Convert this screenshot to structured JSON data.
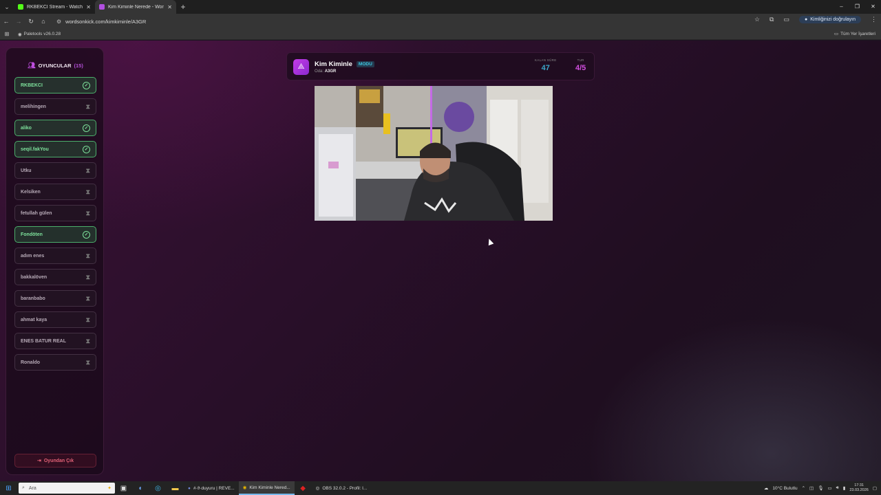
{
  "browser": {
    "tabs": [
      {
        "title": "RKBEKCI Stream - Watch Live o",
        "active": false,
        "favicon_color": "#53fc18"
      },
      {
        "title": "Kim Kiminle Nerede - Words O",
        "active": true,
        "favicon_color": "#b14fe0"
      }
    ],
    "url": "wordsonkick.com/kimkiminle/A3GR",
    "profile_label": "Kimliğinizi doğrulayın",
    "bookmark": "Paletools v26.0.28",
    "all_bookmarks": "Tüm Yer İşaretleri"
  },
  "sidebar": {
    "title": "OYUNCULAR",
    "count_open": "(",
    "count": "15",
    "count_close": ")",
    "players": [
      {
        "name": "RKBEKCI",
        "done": true
      },
      {
        "name": "melihingen",
        "done": false
      },
      {
        "name": "aliko",
        "done": true
      },
      {
        "name": "seqil.fakYou",
        "done": true
      },
      {
        "name": "Utku",
        "done": false
      },
      {
        "name": "Kelsiken",
        "done": false
      },
      {
        "name": "fetullah gülen",
        "done": false
      },
      {
        "name": "Fondöten",
        "done": true
      },
      {
        "name": "adım enes",
        "done": false
      },
      {
        "name": "bakkalöven",
        "done": false
      },
      {
        "name": "baranbabo",
        "done": false
      },
      {
        "name": "ahmat kaya",
        "done": false
      },
      {
        "name": "ENES BATUR REAL",
        "done": false
      },
      {
        "name": "Ronaldo",
        "done": false
      }
    ],
    "leave_label": "Oyundan Çık"
  },
  "game": {
    "title": "Kim Kiminle",
    "mode": "MODU",
    "room_label": "Oda:",
    "room_code": "A3GR",
    "remaining_label": "KALAN SÜRE",
    "remaining_value": "47",
    "round_label": "TUR",
    "round_value": "4/5",
    "colors": {
      "remaining": "#3aa6c8",
      "round": "#d24fe0"
    }
  },
  "taskbar": {
    "search_placeholder": "Ara",
    "apps": [
      {
        "label": "#·ϑ·duyuru | REVE...",
        "active": false
      },
      {
        "label": "Kim Kiminle Nered...",
        "active": true
      },
      {
        "label": "OBS 32.0.2 - Profil: I...",
        "active": false
      }
    ],
    "weather": "10°C  Bulutlu",
    "time": "17:31",
    "date": "23.03.2026"
  }
}
